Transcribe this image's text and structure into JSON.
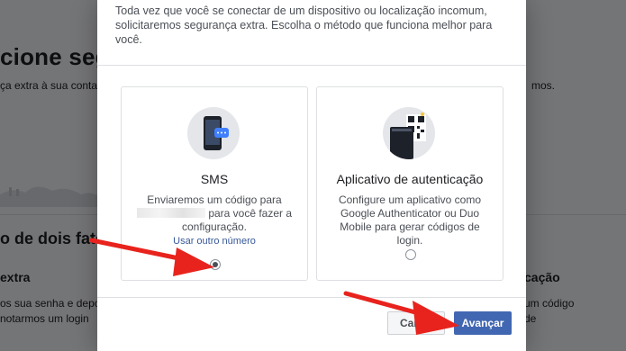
{
  "background": {
    "title": "cione segura",
    "subtitle": "ça extra à sua conta",
    "subtitle_right": "mos.",
    "section": "o de dois fatores",
    "extra_heading": "extra",
    "line1": "os sua senha e depo",
    "line2": "notarmos um login",
    "right_heading": "cação",
    "right_line1": "um código",
    "right_line2": "de"
  },
  "modal": {
    "intro": "Toda vez que você se conectar de um dispositivo ou localização incomum, solicitaremos segurança extra. Escolha o método que funciona melhor para você.",
    "options": [
      {
        "title": "SMS",
        "desc_prefix": "Enviaremos um código para",
        "desc_suffix": "para você fazer a configuração.",
        "link": "Usar outro número",
        "selected": true,
        "icon": "phone-sms-icon"
      },
      {
        "title": "Aplicativo de autenticação",
        "desc": "Configure um aplicativo como Google Authenticator ou Duo Mobile para gerar códigos de login.",
        "selected": false,
        "icon": "qr-code-icon"
      }
    ],
    "buttons": {
      "cancel": "Cance",
      "next": "Avançar"
    }
  },
  "colors": {
    "primary": "#4267b2",
    "link": "#385898",
    "arrow": "#e8231d"
  }
}
